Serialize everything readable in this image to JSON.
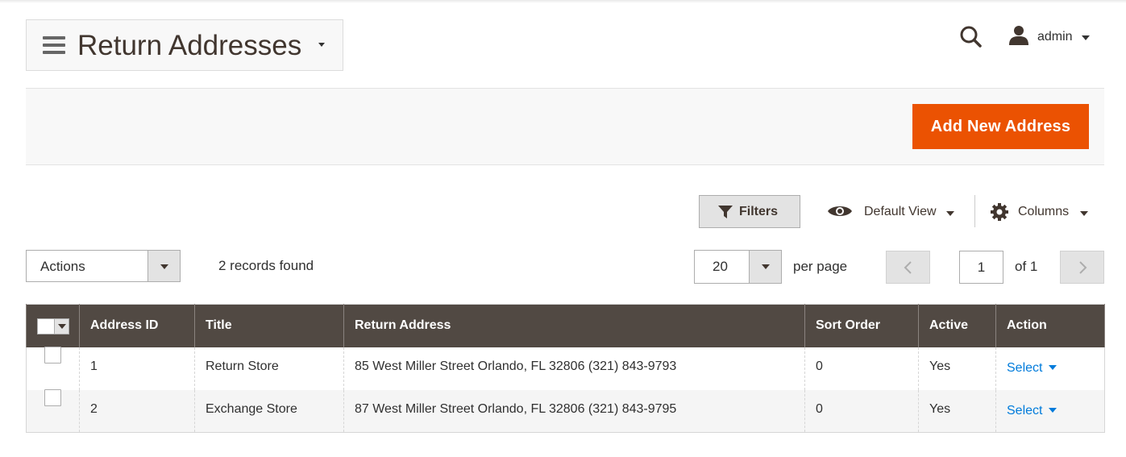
{
  "header": {
    "page_title": "Return Addresses",
    "user_name": "admin"
  },
  "page_actions": {
    "add_button_label": "Add New Address"
  },
  "toolbar": {
    "filters_label": "Filters",
    "view_label": "Default View",
    "columns_label": "Columns"
  },
  "mass_actions": {
    "label": "Actions"
  },
  "records_found": "2 records found",
  "pager": {
    "per_page_value": "20",
    "per_page_label": "per page",
    "current_page": "1",
    "of_label": "of 1"
  },
  "grid": {
    "columns": [
      "Address ID",
      "Title",
      "Return Address",
      "Sort Order",
      "Active",
      "Action"
    ],
    "rows": [
      {
        "id": "1",
        "title": "Return Store",
        "address": "85 West Miller Street Orlando, FL 32806 (321) 843-9793",
        "sort_order": "0",
        "active": "Yes",
        "action": "Select"
      },
      {
        "id": "2",
        "title": "Exchange Store",
        "address": "87 West Miller Street Orlando, FL 32806 (321) 843-9795",
        "sort_order": "0",
        "active": "Yes",
        "action": "Select"
      }
    ]
  },
  "colors": {
    "accent": "#eb5202",
    "grid_header": "#514943",
    "link": "#007bdb"
  },
  "icons": [
    "menu-icon",
    "search-icon",
    "user-icon",
    "filter-icon",
    "eye-icon",
    "gear-icon",
    "chevron-left-icon",
    "chevron-right-icon"
  ]
}
